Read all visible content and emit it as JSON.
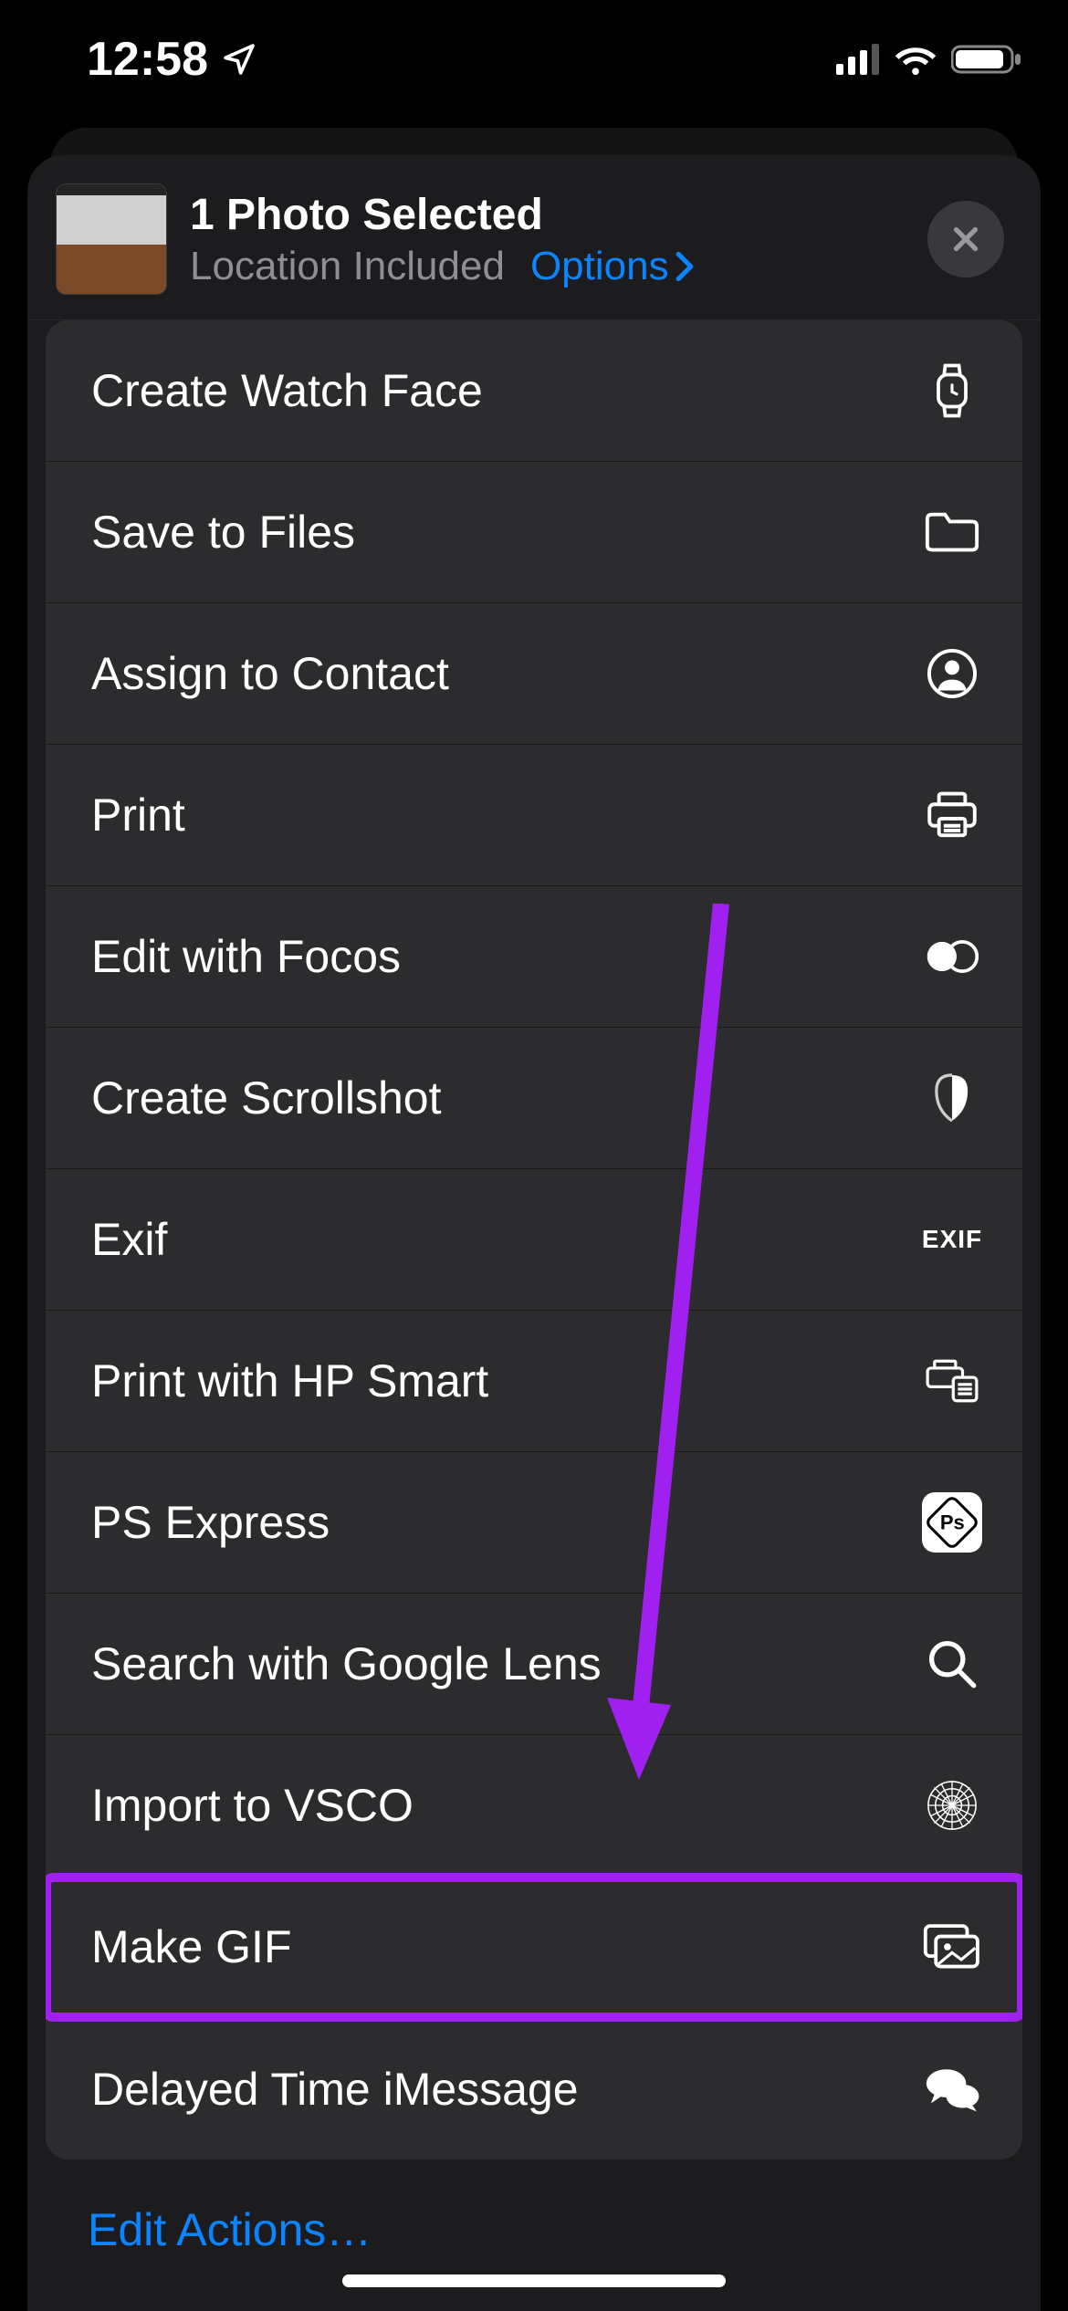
{
  "status": {
    "time": "12:58"
  },
  "header": {
    "title": "1 Photo Selected",
    "subtitle": "Location Included",
    "options_label": "Options"
  },
  "actions": [
    {
      "label": "Create Watch Face",
      "icon": "watch-icon"
    },
    {
      "label": "Save to Files",
      "icon": "folder-icon"
    },
    {
      "label": "Assign to Contact",
      "icon": "contact-icon"
    },
    {
      "label": "Print",
      "icon": "print-icon"
    },
    {
      "label": "Edit with Focos",
      "icon": "focos-icon"
    },
    {
      "label": "Create Scrollshot",
      "icon": "scrollshot-icon"
    },
    {
      "label": "Exif",
      "icon": "exif-icon"
    },
    {
      "label": "Print with HP Smart",
      "icon": "hp-print-icon"
    },
    {
      "label": "PS Express",
      "icon": "ps-icon"
    },
    {
      "label": "Search with Google Lens",
      "icon": "search-icon"
    },
    {
      "label": "Import to VSCO",
      "icon": "vsco-icon"
    },
    {
      "label": "Make GIF",
      "icon": "gallery-icon",
      "highlighted": true
    },
    {
      "label": "Delayed Time iMessage",
      "icon": "chat-icon"
    }
  ],
  "footer": {
    "edit_actions": "Edit Actions…"
  },
  "annotation": {
    "arrow_color": "#a020f0"
  }
}
